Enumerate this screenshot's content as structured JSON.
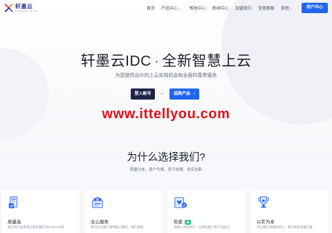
{
  "brand": {
    "name": "轩墨云",
    "subtitle": "XUANMOYUN IDC"
  },
  "nav": {
    "items": [
      {
        "label": "首页",
        "has_caret": false
      },
      {
        "label": "产品中心",
        "has_caret": true
      },
      {
        "label": "帮助中心",
        "has_caret": false
      },
      {
        "label": "新闻中心",
        "has_caret": false
      },
      {
        "label": "加盟我们",
        "has_caret": false
      },
      {
        "label": "宝塔面板",
        "has_caret": false
      },
      {
        "label": "其他",
        "has_caret": true
      }
    ],
    "user_center": "用户中心"
  },
  "hero": {
    "title_left": "轩墨云IDC",
    "title_dot": "·",
    "title_right": "全新智慧上云",
    "subtitle": "为您提供出众的上云实践机会和全面的尊贵服务",
    "login_button": "登入账号",
    "or_text": "or",
    "product_button": "选购产品",
    "product_arrow": "›"
  },
  "watermark": "www.ittellyou.com",
  "why": {
    "title": "为什么选择我们?",
    "subtitle": "质量为本、客户为根、勇于拼搏、务实创新"
  },
  "cards": [
    {
      "title": "质量高",
      "desc": "我们的产品采用全新的魔方云KVM+HV架",
      "badge": false,
      "icon": "device-quality-icon"
    },
    {
      "title": "全心服务",
      "desc": "我们以为客户提供贴心服务，我们将会",
      "badge": false,
      "icon": "service-team-icon"
    },
    {
      "title": "热爱",
      "desc": "选择心中的共产，让所有客户及产品成为",
      "badge": true,
      "icon": "heart-shield-icon"
    },
    {
      "title": "以实为本",
      "desc": "不忘我们创建的初心，我们始终会进行着",
      "badge": false,
      "icon": "trophy-icon"
    }
  ],
  "colors": {
    "accent": "#1f65ee",
    "dark_button": "#1d2346",
    "watermark": "#e4111a",
    "badge": "#2ec48a"
  }
}
